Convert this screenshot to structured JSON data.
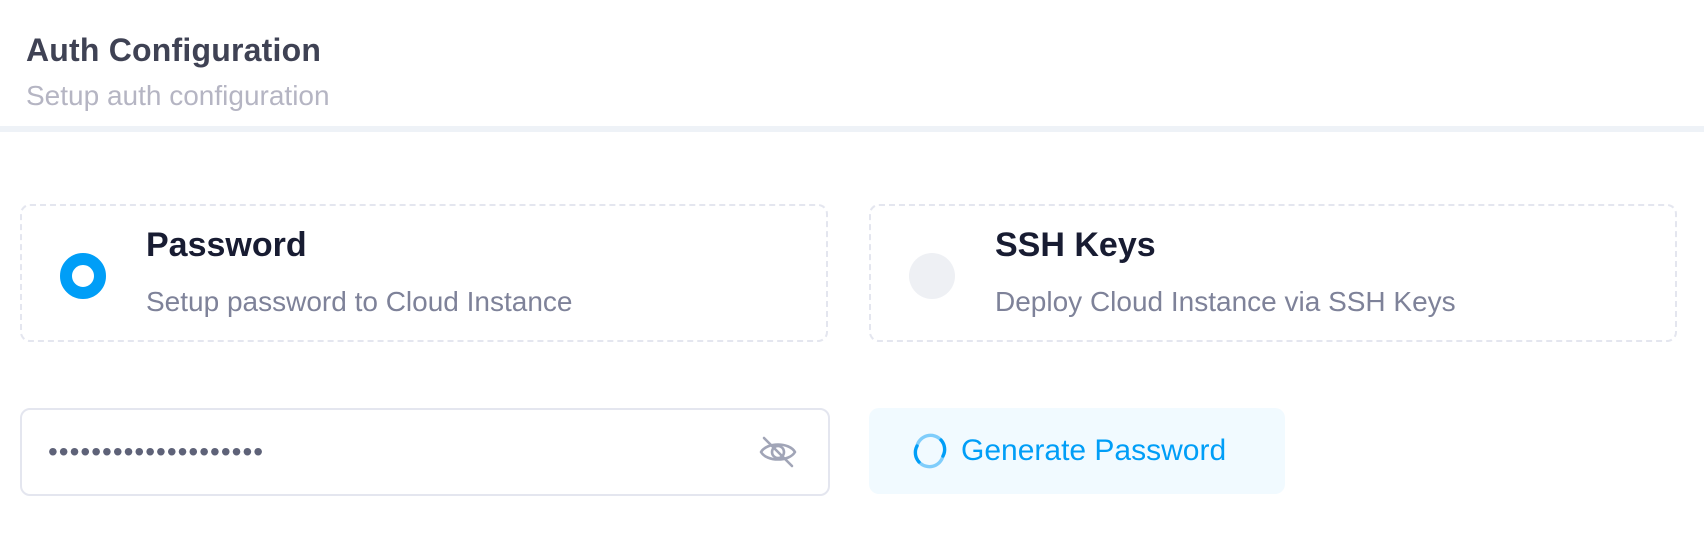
{
  "header": {
    "title": "Auth Configuration",
    "subtitle": "Setup auth configuration"
  },
  "auth_options": [
    {
      "title": "Password",
      "description": "Setup password to Cloud Instance",
      "selected": true
    },
    {
      "title": "SSH Keys",
      "description": "Deploy Cloud Instance via SSH Keys",
      "selected": false
    }
  ],
  "password_field": {
    "value": "••••••••••••••••••••",
    "toggle_icon": "eye-slash-icon"
  },
  "generate_button": {
    "label": "Generate Password",
    "icon": "refresh-icon"
  },
  "colors": {
    "accent": "#009ef7",
    "accent_light": "#f1faff",
    "title_text": "#181c32",
    "muted_text": "#7e8299",
    "border": "#e4e6ef"
  }
}
